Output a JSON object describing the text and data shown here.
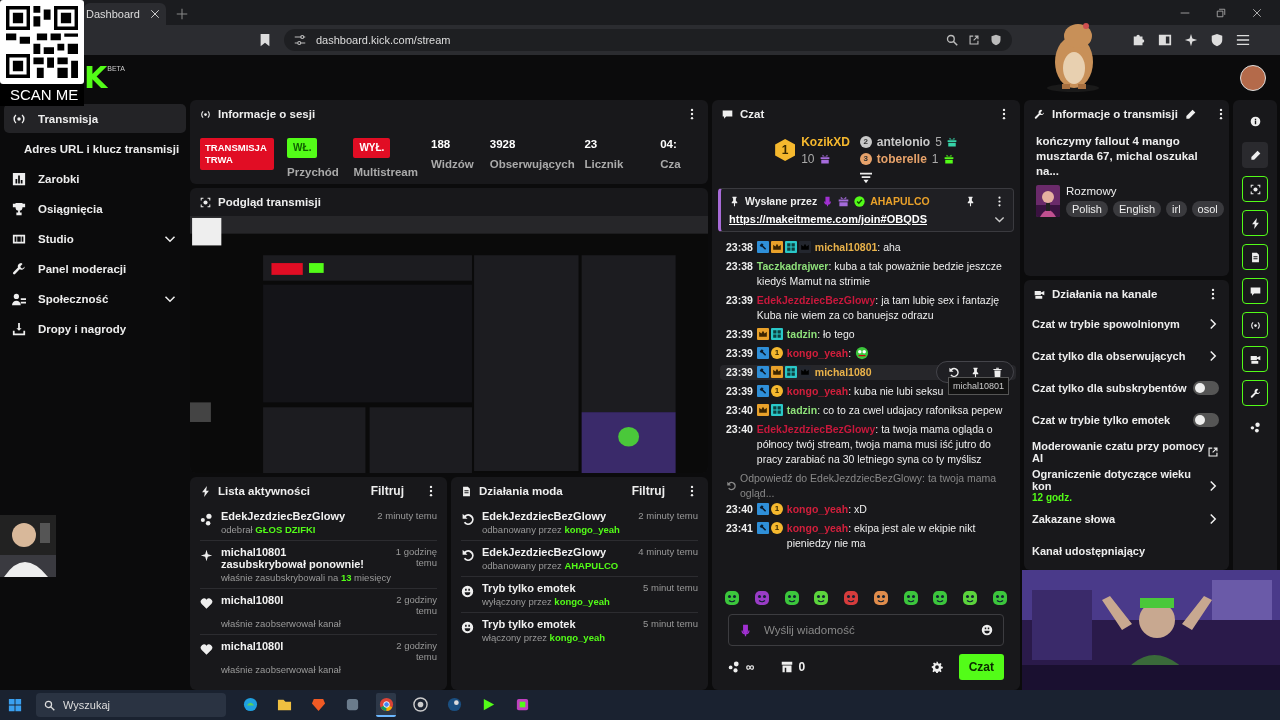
{
  "browser": {
    "tab": {
      "title": "Dashboard"
    },
    "url": "dashboard.kick.com/stream"
  },
  "overlay": {
    "qr_caption": "SCAN ME"
  },
  "logo": {
    "text": "K",
    "badge": "BETA"
  },
  "sidebar": {
    "items": [
      {
        "kind": "broadcast",
        "label": "Transmisja",
        "selected": true
      },
      {
        "kind": "link",
        "label": "Adres URL i klucz transmisji",
        "selected": false
      },
      {
        "kind": "earnings",
        "label": "Zarobki",
        "selected": false
      },
      {
        "kind": "achievements",
        "label": "Osiągnięcia",
        "selected": false
      },
      {
        "kind": "studio",
        "label": "Studio",
        "selected": false,
        "expanded": false
      },
      {
        "kind": "moderation",
        "label": "Panel moderacji",
        "selected": false
      },
      {
        "kind": "community",
        "label": "Społeczność",
        "selected": false,
        "expanded": false
      },
      {
        "kind": "drops",
        "label": "Dropy i nagrody",
        "selected": false
      }
    ]
  },
  "session": {
    "title": "Informacje o sesji",
    "stats": [
      {
        "kind": "live",
        "value": "TRANSMISJA TRWA"
      },
      {
        "kind": "status",
        "value": "WŁ.",
        "label": "Przychód",
        "on": true
      },
      {
        "kind": "status",
        "value": "WYŁ.",
        "label": "Multistream",
        "on": false
      },
      {
        "kind": "number",
        "value": "188",
        "label": "Widzów"
      },
      {
        "kind": "number",
        "value": "3928",
        "label": "Obserwujących"
      },
      {
        "kind": "number",
        "value": "23",
        "label": "Licznik"
      },
      {
        "kind": "number",
        "value": "04:",
        "label": "Cza"
      }
    ]
  },
  "preview": {
    "title": "Podgląd transmisji"
  },
  "activity": {
    "title": "Lista aktywności",
    "filter": "Filtruj",
    "items": [
      {
        "kind": "reward",
        "name": "EdekJezdziecBezGlowy",
        "time": "2 minuty temu",
        "detail": "odebrał ",
        "accent": "GŁOS DZIFKI"
      },
      {
        "kind": "resub",
        "name": "michal10801 zasubskrybował ponownie!",
        "time": "1 godzinę temu",
        "detail": "właśnie zasubskrybowali na ",
        "accent": "13",
        "detail_end": " miesięcy"
      },
      {
        "kind": "follow",
        "name": "michal1080l",
        "time": "2 godziny temu",
        "detail": "właśnie zaobserwował kanał"
      },
      {
        "kind": "follow",
        "name": "michal1080l",
        "time": "2 godziny temu",
        "detail": "właśnie zaobserwował kanał"
      }
    ]
  },
  "mod_actions": {
    "title": "Działania moda",
    "filter": "Filtruj",
    "items": [
      {
        "kind": "unban",
        "name": "EdekJezdziecBezGlowy",
        "time": "2 minuty temu",
        "detail": "odbanowany przez ",
        "accent": "kongo_yeah"
      },
      {
        "kind": "unban",
        "name": "EdekJezdziecBezGlowy",
        "time": "4 minuty temu",
        "detail": "odbanowany przez ",
        "accent": "AHAPULCO"
      },
      {
        "kind": "emote_mode",
        "name": "Tryb tylko emotek",
        "time": "5 minut temu",
        "detail": "wyłączony przez ",
        "accent": "kongo_yeah"
      },
      {
        "kind": "emote_mode",
        "name": "Tryb tylko emotek",
        "time": "5 minut temu",
        "detail": "włączony przez ",
        "accent": "kongo_yeah"
      }
    ]
  },
  "chat": {
    "title": "Czat",
    "leaders": [
      {
        "rank": "1",
        "name": "KozikXD",
        "count": "10",
        "color": "#f5b82e"
      },
      {
        "rank": "2",
        "name": "antelonio",
        "count": "5",
        "color": "#c9c9c9"
      },
      {
        "rank": "3",
        "name": "toberelle",
        "count": "1",
        "color": "#e7a26a"
      }
    ],
    "pinned": {
      "label": "Wysłane przez",
      "user": "AHAPULCO",
      "link": "https://makeitmeme.com/join#OBQDS"
    },
    "messages": [
      {
        "kind": "text",
        "time": "23:38",
        "badges": [
          {
            "kind": "mod"
          },
          {
            "kind": "crown"
          },
          {
            "kind": "sub"
          },
          {
            "kind": "avatar"
          }
        ],
        "user": "michal10801",
        "color": "#e9b24a",
        "text": ": aha"
      },
      {
        "kind": "text",
        "time": "23:38",
        "user": "Taczkadrajwer",
        "color": "#8ee07a",
        "text": ": kuba a tak poważnie bedzie jeszcze kiedyś Mamut na strimie"
      },
      {
        "kind": "text",
        "time": "23:39",
        "user": "EdekJezdziecBezGlowy",
        "color": "#c8183c",
        "text": ": ja tam lubię sex i fantazję Kuba nie wiem za co banuejsz odrazu"
      },
      {
        "kind": "text",
        "time": "23:39",
        "badges": [
          {
            "kind": "crown"
          },
          {
            "kind": "sub"
          }
        ],
        "user": "tadzin",
        "color": "#8ee07a",
        "text": ": ło tego"
      },
      {
        "kind": "emote",
        "time": "23:39",
        "badges": [
          {
            "kind": "mod"
          },
          {
            "kind": "tier",
            "text": "1"
          }
        ],
        "user": "kongo_yeah",
        "color": "#d21f3c",
        "text": ":"
      },
      {
        "kind": "hovered",
        "time": "23:39",
        "badges": [
          {
            "kind": "mod"
          },
          {
            "kind": "crown"
          },
          {
            "kind": "sub"
          },
          {
            "kind": "avatar"
          }
        ],
        "user": "michal1080",
        "color": "#e9b24a",
        "tooltip": "michal10801"
      },
      {
        "kind": "text",
        "time": "23:39",
        "badges": [
          {
            "kind": "mod"
          },
          {
            "kind": "tier",
            "text": "1"
          }
        ],
        "user": "kongo_yeah",
        "color": "#d21f3c",
        "text": ": kuba nie lubi seksu"
      },
      {
        "kind": "text",
        "time": "23:40",
        "badges": [
          {
            "kind": "crown"
          },
          {
            "kind": "sub"
          }
        ],
        "user": "tadzin",
        "color": "#8ee07a",
        "text": ": co to za cwel udajacy rafoniksa pepew"
      },
      {
        "kind": "text",
        "time": "23:40",
        "user": "EdekJezdziecBezGlowy",
        "color": "#c8183c",
        "text": ": ta twoja mama ogląda o północy twój stream, twoja mama musi iść jutro do pracy zarabiać na 30 letniego syna co ty myślisz"
      },
      {
        "kind": "text",
        "time": "23:40",
        "reply": "Odpowiedź do EdekJezdziecBezGlowy: ta twoja mama ogląd...",
        "badges": [
          {
            "kind": "mod"
          },
          {
            "kind": "tier",
            "text": "1"
          }
        ],
        "user": "kongo_yeah",
        "color": "#d21f3c",
        "text": ": xD"
      },
      {
        "kind": "text",
        "time": "23:41",
        "badges": [
          {
            "kind": "mod"
          },
          {
            "kind": "tier",
            "text": "1"
          }
        ],
        "user": "kongo_yeah",
        "color": "#d21f3c",
        "text": ": ekipa jest ale w ekipie nikt pieniedzy nie ma"
      }
    ],
    "input": {
      "placeholder": "Wyślij wiadomość"
    },
    "points": "∞",
    "drops": "0",
    "send": "Czat"
  },
  "stream_info": {
    "title": "Informacje o transmisji",
    "stream_title": "kończymy fallout 4 mango musztarda 67, michal oszukal na...",
    "category": "Rozmowy",
    "tags": [
      "Polish",
      "English",
      "irl",
      "osol"
    ]
  },
  "channel_actions": {
    "title": "Działania na kanale",
    "items": [
      {
        "kind": "link",
        "label": "Czat w trybie spowolnionym"
      },
      {
        "kind": "link",
        "label": "Czat tylko dla obserwujących"
      },
      {
        "kind": "toggle",
        "label": "Czat tylko dla subskrybentów",
        "on": false
      },
      {
        "kind": "toggle",
        "label": "Czat w trybie tylko emotek",
        "on": false
      },
      {
        "kind": "external",
        "label": "Moderowanie czatu przy pomocy AI"
      },
      {
        "kind": "link",
        "label": "Ograniczenie dotyczące wieku kon",
        "value": "12 godz."
      },
      {
        "kind": "link",
        "label": "Zakazane słowa"
      },
      {
        "kind": "plain",
        "label": "Kanał udostępniający"
      }
    ]
  },
  "rail": [
    {
      "kind": "info",
      "active": false,
      "selected": false
    },
    {
      "kind": "edit",
      "active": false,
      "selected": true
    },
    {
      "kind": "preview",
      "active": true,
      "selected": false
    },
    {
      "kind": "activity",
      "active": true,
      "selected": false
    },
    {
      "kind": "modlog",
      "active": true,
      "selected": false
    },
    {
      "kind": "chat",
      "active": true,
      "selected": false
    },
    {
      "kind": "session",
      "active": true,
      "selected": false
    },
    {
      "kind": "actions",
      "active": true,
      "selected": false
    },
    {
      "kind": "info_panel",
      "active": true,
      "selected": false
    },
    {
      "kind": "more",
      "active": false,
      "selected": false
    }
  ],
  "taskbar": {
    "search": "Wyszukaj",
    "apps": [
      {
        "kind": "edge",
        "active": false
      },
      {
        "kind": "files",
        "active": false
      },
      {
        "kind": "brave",
        "active": false
      },
      {
        "kind": "tool",
        "active": false
      },
      {
        "kind": "chrome",
        "active": true
      },
      {
        "kind": "obs",
        "active": false
      },
      {
        "kind": "steam",
        "active": false
      },
      {
        "kind": "play",
        "active": false
      },
      {
        "kind": "dev",
        "active": false
      }
    ]
  }
}
